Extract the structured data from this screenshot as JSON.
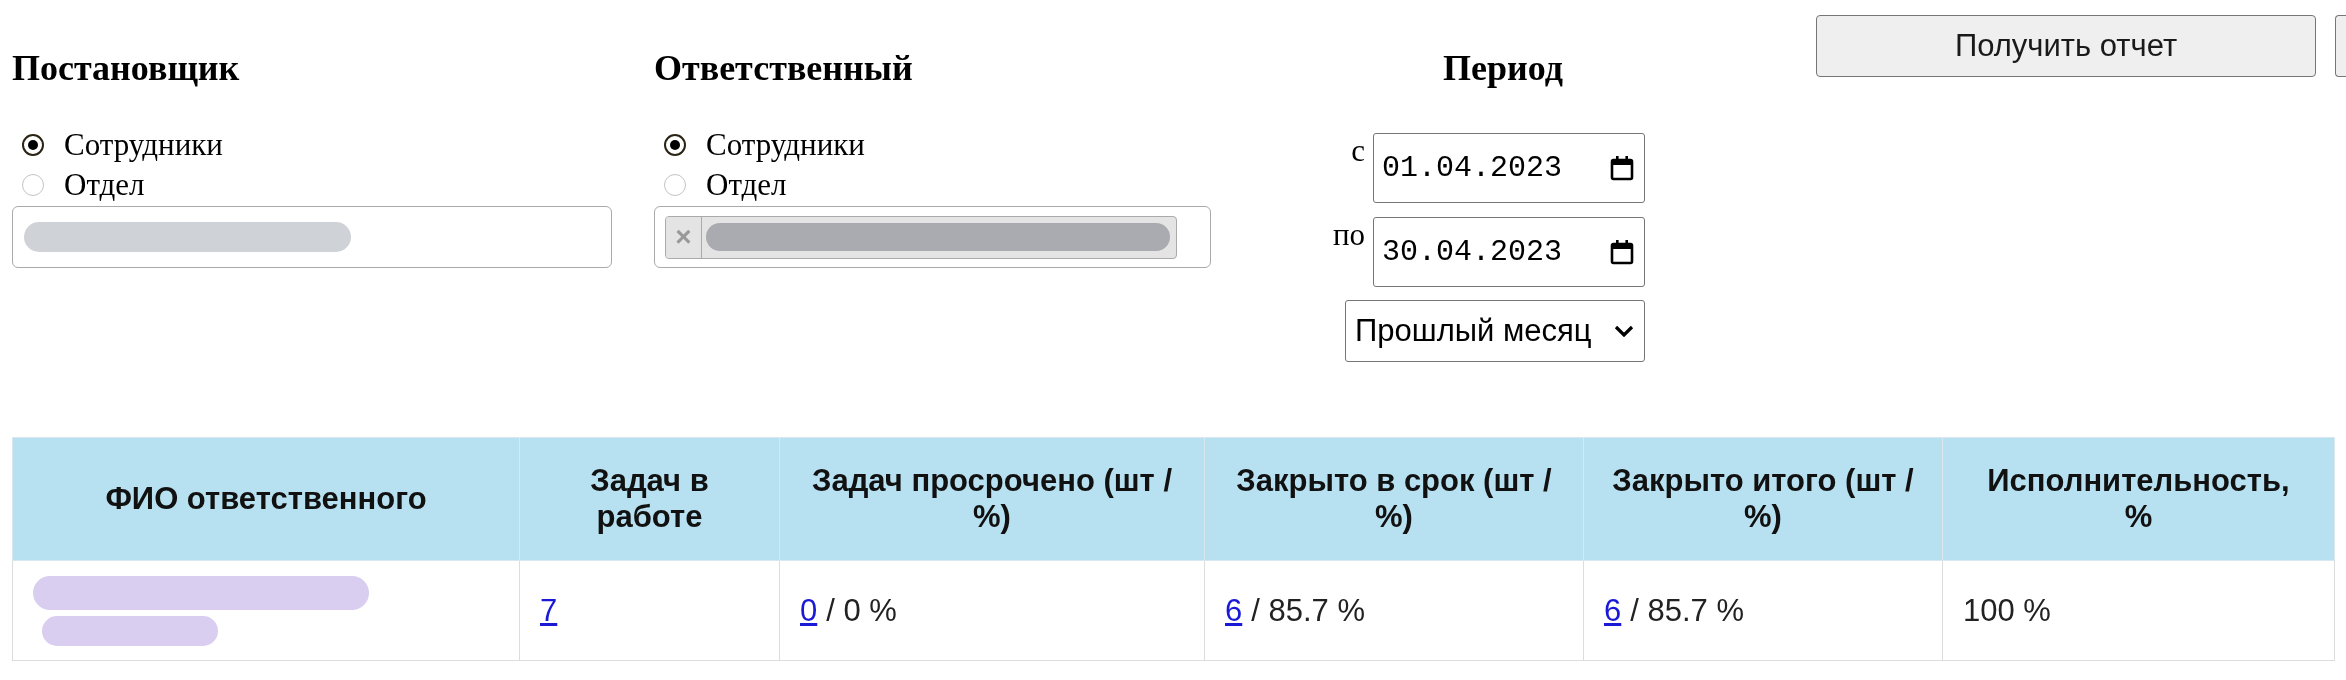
{
  "filters": [
    {
      "kind": "single",
      "title": "Постановщик",
      "options": [
        {
          "label": "Сотрудники",
          "selected": true
        },
        {
          "label": "Отдел",
          "selected": false
        }
      ],
      "field": {
        "redacted": true
      }
    },
    {
      "kind": "multi",
      "title": "Ответственный",
      "options": [
        {
          "label": "Сотрудники",
          "selected": true
        },
        {
          "label": "Отдел",
          "selected": false
        }
      ],
      "field": {
        "tags": [
          {
            "remove": "×",
            "redacted": true
          }
        ]
      }
    }
  ],
  "period": {
    "title": "Период",
    "from": {
      "label": "с",
      "value": "01.04.2023"
    },
    "to": {
      "label": "по",
      "value": "30.04.2023"
    },
    "preset": "Прошлый месяц"
  },
  "buttons": [
    {
      "kind": "full",
      "label": "Получить отчет"
    },
    {
      "kind": "clipped"
    }
  ],
  "table": {
    "columns": [
      "ФИО ответственного",
      "Задач в работе",
      "Задач просрочено (шт / %)",
      "Закрыто в срок (шт / %)",
      "Закрыто итого (шт / %)",
      "Исполнительность, %"
    ],
    "rows": [
      {
        "cells": [
          {
            "kind": "redacted"
          },
          {
            "kind": "link",
            "link": "7"
          },
          {
            "kind": "link",
            "link": "0",
            "suffix": "/ 0 %"
          },
          {
            "kind": "link",
            "link": "6",
            "suffix": "/ 85.7 %"
          },
          {
            "kind": "link",
            "link": "6",
            "suffix": "/ 85.7 %"
          },
          {
            "kind": "text",
            "text": "100 %"
          }
        ]
      }
    ]
  }
}
